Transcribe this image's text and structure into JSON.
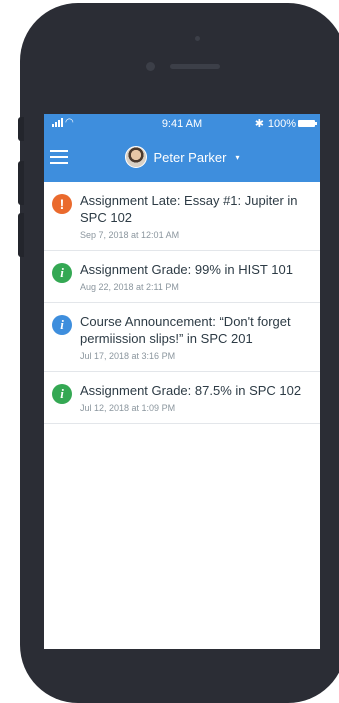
{
  "status_bar": {
    "time": "9:41 AM",
    "bluetooth": "✱",
    "battery_percent": "100%"
  },
  "header": {
    "menu_icon": "hamburger-menu-icon",
    "user_name": "Peter Parker",
    "caret": "▾"
  },
  "notifications": [
    {
      "type": "late",
      "icon": "exclamation-icon",
      "glyph": "!",
      "color": "#ea6a2d",
      "title": "Assignment Late: Essay #1: Jupiter in SPC 102",
      "date": "Sep 7, 2018 at 12:01 AM"
    },
    {
      "type": "grade",
      "icon": "info-icon",
      "glyph": "i",
      "color": "#34a853",
      "title": "Assignment Grade: 99% in HIST 101",
      "date": "Aug 22, 2018 at 2:11 PM"
    },
    {
      "type": "announcement",
      "icon": "info-icon",
      "glyph": "i",
      "color": "#3e8edd",
      "title": "Course Announcement: “Don't forget permiission slips!” in SPC 201",
      "date": "Jul 17, 2018 at 3:16 PM"
    },
    {
      "type": "grade",
      "icon": "info-icon",
      "glyph": "i",
      "color": "#34a853",
      "title": "Assignment Grade: 87.5% in SPC 102",
      "date": "Jul 12, 2018 at 1:09 PM"
    }
  ],
  "colors": {
    "app_bar": "#3e8edd",
    "phone_frame": "#2b2d35"
  }
}
